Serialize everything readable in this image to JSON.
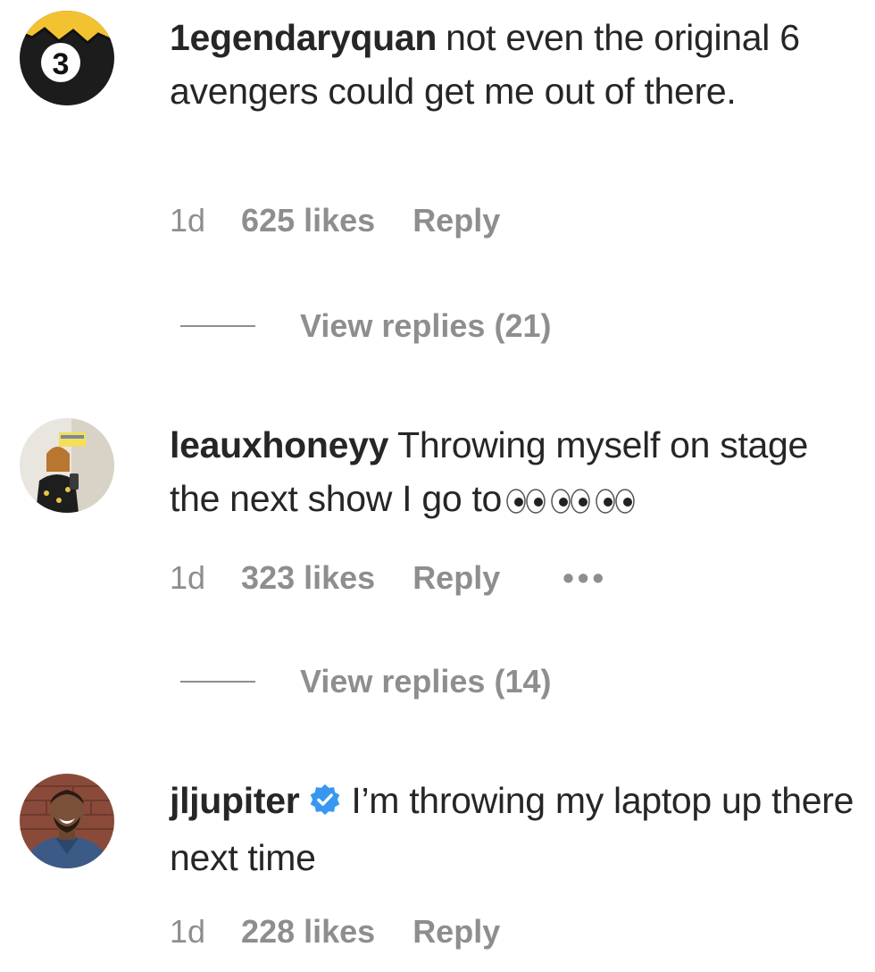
{
  "comments": [
    {
      "avatar": "jersey-number-3-avatar",
      "avatar_text": "3",
      "username": "1egendaryquan",
      "verified": false,
      "text": "not even the original 6 avengers could get me out of there.",
      "time": "1d",
      "likes": "625 likes",
      "reply_label": "Reply",
      "view_replies": "View replies (21)"
    },
    {
      "avatar": "mirror-selfie-avatar",
      "username": "leauxhoneyy",
      "verified": false,
      "text": "Throwing myself on stage the next show I go to",
      "emoji": "eyes-emoji-x3",
      "time": "1d",
      "likes": "323 likes",
      "reply_label": "Reply",
      "more_label": "•••",
      "view_replies": "View replies (14)"
    },
    {
      "avatar": "smiling-man-avatar",
      "username": "jljupiter",
      "verified": true,
      "text": "I’m throwing my laptop up there next time",
      "time": "1d",
      "likes": "228 likes",
      "reply_label": "Reply"
    }
  ],
  "colors": {
    "text": "#262626",
    "secondary": "#8e8e8e",
    "verified_blue": "#3897f0"
  }
}
